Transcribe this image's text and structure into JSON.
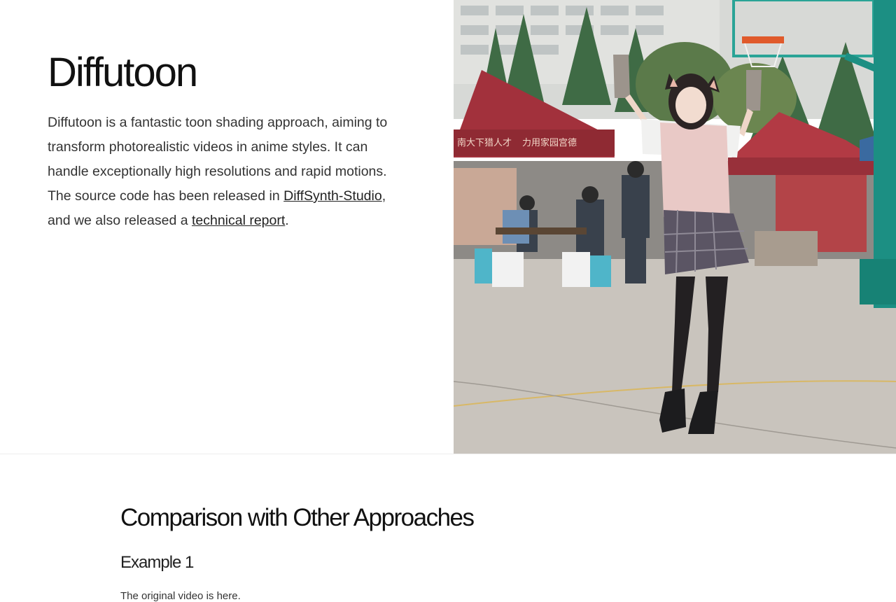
{
  "hero": {
    "title": "Diffutoon",
    "desc_text_1": "Diffutoon is a fantastic toon shading approach, aiming to transform photorealistic videos in anime styles. It can handle exceptionally high resolutions and rapid motions. The source code has been released in ",
    "link_diffsynth": "DiffSynth-Studio",
    "desc_text_2": ", and we also released a ",
    "link_report": "technical report",
    "desc_text_3": ".",
    "banner_signs": [
      "南大下猎人才",
      "力用家园宫德"
    ]
  },
  "comparison": {
    "section_title": "Comparison with Other Approaches",
    "example_title": "Example 1",
    "example_note": "The original video is here."
  },
  "colors": {
    "tent_red": "#a2313c",
    "hoop_teal": "#1c8f83",
    "ground": "#c6c1b9",
    "sky_building": "#cfd3d2"
  }
}
